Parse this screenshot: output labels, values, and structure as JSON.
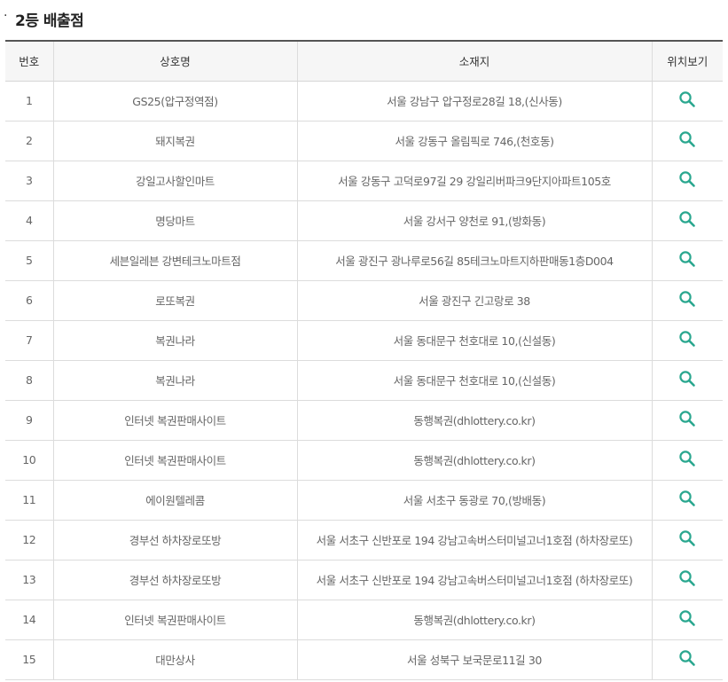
{
  "section": {
    "bullet": "·",
    "title": "2등 배출점"
  },
  "table": {
    "headers": {
      "no": "번호",
      "name": "상호명",
      "address": "소재지",
      "location": "위치보기"
    },
    "rows": [
      {
        "no": "1",
        "name": "GS25(압구정역점)",
        "address": "서울 강남구 압구정로28길 18,(신사동)"
      },
      {
        "no": "2",
        "name": "돼지복권",
        "address": "서울 강동구 올림픽로 746,(천호동)"
      },
      {
        "no": "3",
        "name": "강일고사할인마트",
        "address": "서울 강동구 고덕로97길 29 강일리버파크9단지아파트105호"
      },
      {
        "no": "4",
        "name": "명당마트",
        "address": "서울 강서구 양천로 91,(방화동)"
      },
      {
        "no": "5",
        "name": "세븐일레븐 강변테크노마트점",
        "address": "서울 광진구 광나루로56길 85테크노마트지하판매동1층D004"
      },
      {
        "no": "6",
        "name": "로또복권",
        "address": "서울 광진구 긴고랑로 38"
      },
      {
        "no": "7",
        "name": "복권나라",
        "address": "서울 동대문구 천호대로 10,(신설동)"
      },
      {
        "no": "8",
        "name": "복권나라",
        "address": "서울 동대문구 천호대로 10,(신설동)"
      },
      {
        "no": "9",
        "name": "인터넷 복권판매사이트",
        "address": "동행복권(dhlottery.co.kr)"
      },
      {
        "no": "10",
        "name": "인터넷 복권판매사이트",
        "address": "동행복권(dhlottery.co.kr)"
      },
      {
        "no": "11",
        "name": "에이원텔레콤",
        "address": "서울 서초구 동광로 70,(방배동)"
      },
      {
        "no": "12",
        "name": "경부선 하차장로또방",
        "address": "서울 서초구 신반포로 194 강남고속버스터미널고너1호점 (하차장로또)"
      },
      {
        "no": "13",
        "name": "경부선 하차장로또방",
        "address": "서울 서초구 신반포로 194 강남고속버스터미널고너1호점 (하차장로또)"
      },
      {
        "no": "14",
        "name": "인터넷 복권판매사이트",
        "address": "동행복권(dhlottery.co.kr)"
      },
      {
        "no": "15",
        "name": "대만상사",
        "address": "서울 성북구 보국문로11길 30"
      }
    ]
  },
  "colors": {
    "accent": "#2aa78f",
    "header_bg": "#f6f6f6"
  },
  "icons": {
    "location": "magnifier-icon"
  }
}
